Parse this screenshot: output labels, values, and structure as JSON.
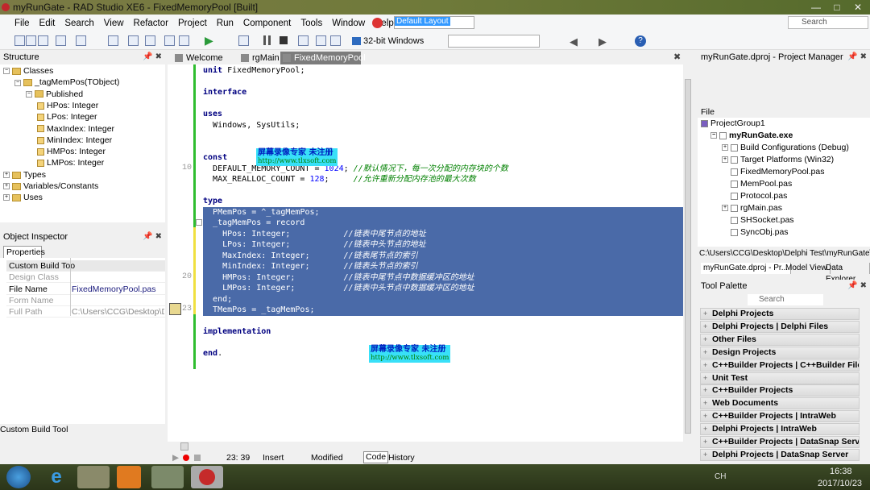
{
  "window": {
    "title": "myRunGate - RAD Studio XE6 - FixedMemoryPool [Built]"
  },
  "menu": [
    "File",
    "Edit",
    "Search",
    "View",
    "Refactor",
    "Project",
    "Run",
    "Component",
    "Tools",
    "Window",
    "Help"
  ],
  "layout_select": "Default Layout",
  "search_placeholder": "Search",
  "toolbar": {
    "platform": "32-bit Windows"
  },
  "structure": {
    "title": "Structure",
    "items": [
      {
        "label": "Classes",
        "level": 0
      },
      {
        "label": "_tagMemPos(TObject)",
        "level": 1
      },
      {
        "label": "Published",
        "level": 2
      },
      {
        "label": "HPos: Integer",
        "level": 3
      },
      {
        "label": "LPos: Integer",
        "level": 3
      },
      {
        "label": "MaxIndex: Integer",
        "level": 3
      },
      {
        "label": "MinIndex: Integer",
        "level": 3
      },
      {
        "label": "HMPos: Integer",
        "level": 3
      },
      {
        "label": "LMPos: Integer",
        "level": 3
      },
      {
        "label": "Types",
        "level": 0
      },
      {
        "label": "Variables/Constants",
        "level": 0
      },
      {
        "label": "Uses",
        "level": 0
      }
    ]
  },
  "object_inspector": {
    "title": "Object Inspector",
    "tab": "Properties",
    "rows": [
      {
        "key": "Custom Build Too",
        "value": ""
      },
      {
        "key": "Design Class",
        "value": ""
      },
      {
        "key": "File Name",
        "value": "FixedMemoryPool.pas"
      },
      {
        "key": "Form Name",
        "value": ""
      },
      {
        "key": "Full Path",
        "value": "C:\\Users\\CCG\\Desktop\\Delp"
      }
    ],
    "footer": "Custom Build Tool"
  },
  "editor": {
    "tabs": [
      "Welcome Page",
      "rgMain",
      "FixedMemoryPool"
    ],
    "active_tab": "FixedMemoryPool",
    "line_numbers": [
      "10",
      "20",
      "23"
    ],
    "lines": [
      "unit FixedMemoryPool;",
      "",
      "interface",
      "",
      "uses",
      "  Windows, SysUtils;",
      "",
      "",
      "const",
      "  DEFAULT_MEMORY_COUNT = 1024; //默认情况下，每一次分配的内存块的个数",
      "  MAX_REALLOC_COUNT = 128;     //允许重新分配内存池的最大次数",
      "",
      "type",
      "  PMemPos = ^_tagMemPos;",
      "  _tagMemPos = record",
      "    HPos: Integer;           //链表中尾节点的地址",
      "    LPos: Integer;           //链表中头节点的地址",
      "    MaxIndex: Integer;       //链表尾节点的索引",
      "    MinIndex: Integer;       //链表头节点的索引",
      "    HMPos: Integer;          //链表中尾节点中数据缓冲区的地址",
      "    LMPos: Integer;          //链表中头节点中数据缓冲区的地址",
      "  end;",
      "  TMemPos = _tagMemPos;",
      "",
      "implementation",
      "",
      "end."
    ],
    "watermark": {
      "line1": "屏幕录像专家      未注册",
      "line2": "http://www.tlxsoft.com"
    }
  },
  "status": {
    "position": "23: 39",
    "mode": "Insert",
    "state": "Modified",
    "tabs": [
      "Code",
      "History"
    ]
  },
  "project_manager": {
    "title": "myRunGate.dproj - Project Manager",
    "column": "File",
    "items": [
      {
        "label": "ProjectGroup1",
        "level": 0
      },
      {
        "label": "myRunGate.exe",
        "level": 1
      },
      {
        "label": "Build Configurations (Debug)",
        "level": 2
      },
      {
        "label": "Target Platforms (Win32)",
        "level": 2
      },
      {
        "label": "FixedMemoryPool.pas",
        "level": 2
      },
      {
        "label": "MemPool.pas",
        "level": 2
      },
      {
        "label": "Protocol.pas",
        "level": 2
      },
      {
        "label": "rgMain.pas",
        "level": 2
      },
      {
        "label": "SHSocket.pas",
        "level": 2
      },
      {
        "label": "SyncObj.pas",
        "level": 2
      }
    ],
    "path": "C:\\Users\\CCG\\Desktop\\Delphi Test\\myRunGate\\Fi",
    "tabs": [
      "myRunGate.dproj - Pr...",
      "Model View",
      "Data Explorer"
    ]
  },
  "tool_palette": {
    "title": "Tool Palette",
    "search_placeholder": "Search",
    "categories": [
      "Delphi Projects",
      "Delphi Projects | Delphi Files",
      "Other Files",
      "Design Projects",
      "C++Builder Projects | C++Builder Files",
      "Unit Test",
      "C++Builder Projects",
      "Web Documents",
      "C++Builder Projects | IntraWeb",
      "Delphi Projects | IntraWeb",
      "C++Builder Projects | DataSnap Server",
      "Delphi Projects | DataSnap Server"
    ]
  },
  "taskbar": {
    "time": "16:38",
    "date": "2017/10/23",
    "lang": "CH"
  },
  "colors": {
    "selection": "#4a6aa8",
    "keyword": "#000080",
    "comment": "#008000",
    "number": "#0000ff",
    "modified_bar": "#2fbd2f"
  }
}
